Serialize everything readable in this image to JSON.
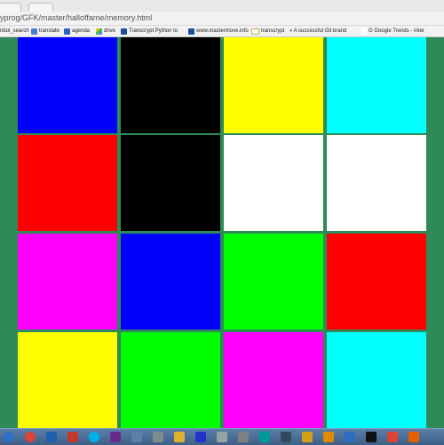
{
  "browser": {
    "url": "yprog/GFK/master/halloffame/memory.html",
    "bookmarks": [
      {
        "label": "nbol_search",
        "icon": "none"
      },
      {
        "label": "translate",
        "icon": "translate"
      },
      {
        "label": "agenda",
        "icon": "agenda"
      },
      {
        "label": "drive",
        "icon": "drive"
      },
      {
        "label": "Transcrypt Python to",
        "icon": "transcrypt"
      },
      {
        "label": "www.mastermove.info",
        "icon": "mastermove"
      },
      {
        "label": "transcrypt",
        "icon": "folder"
      },
      {
        "label": "» A successful Git brand",
        "icon": "none"
      },
      {
        "label": "G Google Trends - Inter",
        "icon": "google"
      }
    ]
  },
  "board": {
    "rows": 4,
    "cols": 4,
    "cards": [
      {
        "color": "#0000ff"
      },
      {
        "color": "#000000"
      },
      {
        "color": "#ffff00"
      },
      {
        "color": "#00ffff"
      },
      {
        "color": "#ff0000"
      },
      {
        "color": "#000000"
      },
      {
        "color": "#ffffff"
      },
      {
        "color": "#ffffff"
      },
      {
        "color": "#ff00ff"
      },
      {
        "color": "#0000ff"
      },
      {
        "color": "#00ff00"
      },
      {
        "color": "#ff0000"
      },
      {
        "color": "#ffff00"
      },
      {
        "color": "#00ff00"
      },
      {
        "color": "#ff00ff"
      },
      {
        "color": "#00ffff"
      }
    ],
    "background": "#2e8b57"
  },
  "taskbar": {
    "icons": [
      {
        "name": "start-icon",
        "color": "#2d6fc2"
      },
      {
        "name": "chrome-icon",
        "color": "#db4437"
      },
      {
        "name": "psd-icon",
        "color": "#1f5fb0"
      },
      {
        "name": "app-red-icon",
        "color": "#c0392b"
      },
      {
        "name": "skype-icon",
        "color": "#00aff0"
      },
      {
        "name": "app-purple-icon",
        "color": "#6a2a8a"
      },
      {
        "name": "app-folder-icon",
        "color": "#5b7fa6"
      },
      {
        "name": "app-doc-icon",
        "color": "#7f8c8d"
      },
      {
        "name": "app-yellow-icon",
        "color": "#e0b030"
      },
      {
        "name": "app-blue-diamond-icon",
        "color": "#2233cc"
      },
      {
        "name": "app-settings-icon",
        "color": "#95a5a6"
      },
      {
        "name": "app-gray-icon",
        "color": "#808080"
      },
      {
        "name": "arduino-icon",
        "color": "#00979c"
      },
      {
        "name": "app-bug-icon",
        "color": "#34495e"
      },
      {
        "name": "app-star-icon",
        "color": "#d4a017"
      },
      {
        "name": "app-orange-icon",
        "color": "#e08a00"
      },
      {
        "name": "app-blue-icon",
        "color": "#2a6fc2"
      },
      {
        "name": "terminal-icon",
        "color": "#111111"
      },
      {
        "name": "app-chrome2-icon",
        "color": "#db4437"
      },
      {
        "name": "app-firefox-icon",
        "color": "#e66000"
      }
    ]
  }
}
